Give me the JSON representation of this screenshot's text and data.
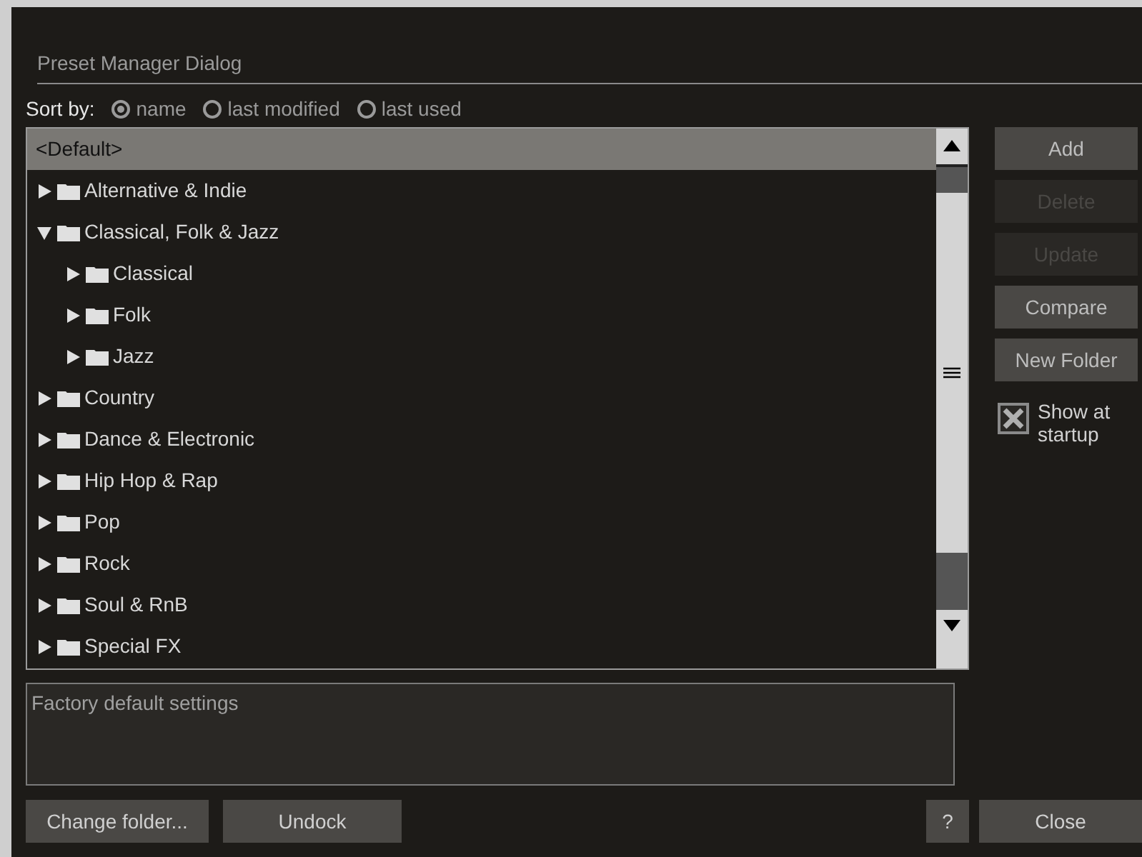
{
  "dialog": {
    "title": "Preset Manager Dialog"
  },
  "sort": {
    "label": "Sort by:",
    "options": [
      {
        "label": "name",
        "selected": true
      },
      {
        "label": "last modified",
        "selected": false
      },
      {
        "label": "last used",
        "selected": false
      }
    ]
  },
  "tree": [
    {
      "kind": "preset",
      "label": "<Default>",
      "selected": true
    },
    {
      "kind": "folder",
      "label": "Alternative & Indie",
      "expanded": false,
      "selected": false
    },
    {
      "kind": "folder",
      "label": "Classical, Folk & Jazz",
      "expanded": true,
      "selected": false,
      "children": [
        {
          "kind": "folder",
          "label": "Classical",
          "expanded": false,
          "selected": false
        },
        {
          "kind": "folder",
          "label": "Folk",
          "expanded": false,
          "selected": false
        },
        {
          "kind": "folder",
          "label": "Jazz",
          "expanded": false,
          "selected": false
        }
      ]
    },
    {
      "kind": "folder",
      "label": "Country",
      "expanded": false,
      "selected": false
    },
    {
      "kind": "folder",
      "label": "Dance & Electronic",
      "expanded": false,
      "selected": false
    },
    {
      "kind": "folder",
      "label": "Hip Hop & Rap",
      "expanded": false,
      "selected": false
    },
    {
      "kind": "folder",
      "label": "Pop",
      "expanded": false,
      "selected": false
    },
    {
      "kind": "folder",
      "label": "Rock",
      "expanded": false,
      "selected": false
    },
    {
      "kind": "folder",
      "label": "Soul & RnB",
      "expanded": false,
      "selected": false
    },
    {
      "kind": "folder",
      "label": "Special FX",
      "expanded": false,
      "selected": false
    }
  ],
  "actions": [
    {
      "label": "Add",
      "disabled": false
    },
    {
      "label": "Delete",
      "disabled": true
    },
    {
      "label": "Update",
      "disabled": true
    },
    {
      "label": "Compare",
      "disabled": false
    },
    {
      "label": "New Folder",
      "disabled": false
    }
  ],
  "show_at_startup": {
    "label": "Show at startup",
    "checked": true
  },
  "description": {
    "value": "Factory default settings"
  },
  "footer": {
    "left": [
      "Change folder...",
      "Undock"
    ],
    "help": "?",
    "close": "Close"
  }
}
